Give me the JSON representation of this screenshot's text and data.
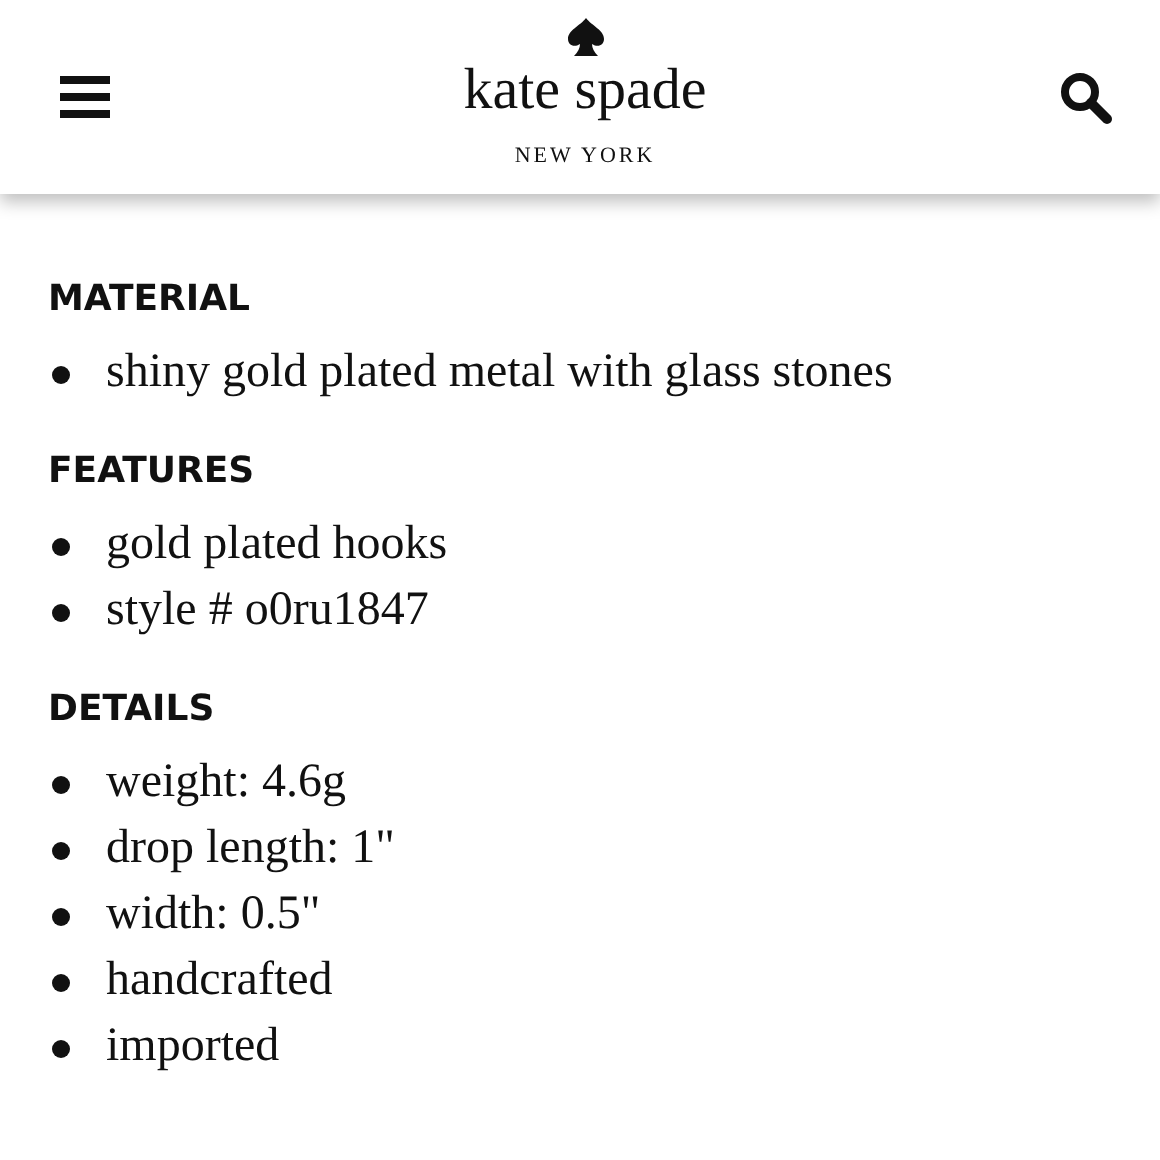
{
  "header": {
    "brand": "kate spade",
    "tagline": "NEW YORK"
  },
  "sections": [
    {
      "heading": "MATERIAL",
      "items": [
        "shiny gold plated metal with glass stones"
      ]
    },
    {
      "heading": "FEATURES",
      "items": [
        "gold plated hooks",
        "style # o0ru1847"
      ]
    },
    {
      "heading": "DETAILS",
      "items": [
        "weight: 4.6g",
        "drop length: 1\"",
        "width: 0.5\"",
        "handcrafted",
        "imported"
      ]
    }
  ]
}
